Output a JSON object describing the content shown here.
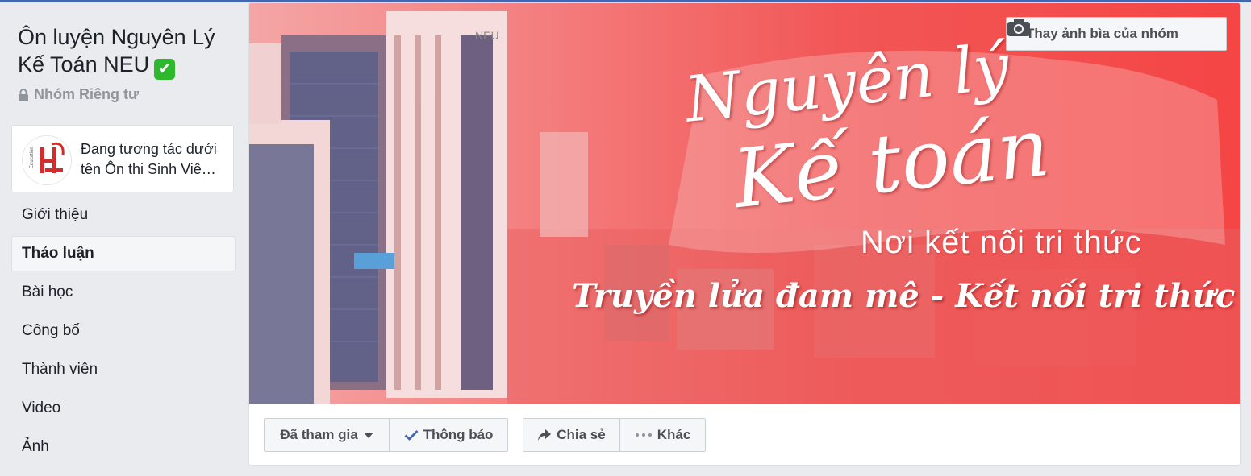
{
  "group": {
    "title": "Ôn luyện Nguyên Lý Kế Toán NEU",
    "verified_badge": "✔",
    "privacy": "Nhóm Riêng tư"
  },
  "identity": {
    "line1": "Đang tương tác dưới",
    "line2": "tên Ôn thi Sinh Viê…",
    "avatar_text": "H",
    "avatar_sub": "Education"
  },
  "nav": {
    "items": [
      {
        "label": "Giới thiệu",
        "active": false
      },
      {
        "label": "Thảo luận",
        "active": true
      },
      {
        "label": "Bài học",
        "active": false
      },
      {
        "label": "Công bố",
        "active": false
      },
      {
        "label": "Thành viên",
        "active": false
      },
      {
        "label": "Video",
        "active": false
      },
      {
        "label": "Ảnh",
        "active": false
      }
    ]
  },
  "cover": {
    "change_cover_label": "Thay ảnh bìa của nhóm",
    "title_line1": "Nguyên lý",
    "title_line2": "Kế toán",
    "subtitle": "Nơi kết nối tri thức",
    "slogan": "Truyền lửa đam mê - Kết nối tri thức",
    "building_sign": "NEU"
  },
  "actions": {
    "joined": "Đã tham gia",
    "notify": "Thông báo",
    "share": "Chia sẻ",
    "more": "Khác"
  },
  "colors": {
    "brand": "#4267b2",
    "verified": "#2eb82e",
    "cover_red": "#f54545"
  }
}
